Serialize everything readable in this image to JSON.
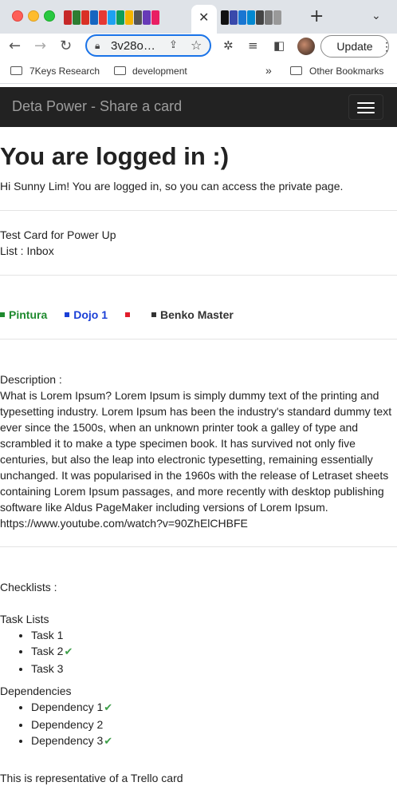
{
  "browser": {
    "url": "3v28o…",
    "update_label": "Update",
    "bookmarks": [
      "7Keys Research",
      "development"
    ],
    "bookmarks_more": "»",
    "other_bookmarks": "Other Bookmarks"
  },
  "navbar": {
    "brand": "Deta Power - Share a card"
  },
  "page": {
    "heading": "You are logged in :)",
    "greeting": "Hi Sunny Lim! You are logged in, so you can access the private page.",
    "card_name": "Test Card for Power Up",
    "card_list": "List : Inbox",
    "labels": [
      {
        "text": "Pintura",
        "color": "#1e8a2e"
      },
      {
        "text": "Dojo 1",
        "color": "#1a3fd6"
      },
      {
        "text": "",
        "color": "#e11d2b"
      },
      {
        "text": "Benko Master",
        "color": "#333333"
      }
    ],
    "description_label": "Description :",
    "description_text": "What is Lorem Ipsum? Lorem Ipsum is simply dummy text of the printing and typesetting industry. Lorem Ipsum has been the industry's standard dummy text ever since the 1500s, when an unknown printer took a galley of type and scrambled it to make a type specimen book. It has survived not only five centuries, but also the leap into electronic typesetting, remaining essentially unchanged. It was popularised in the 1960s with the release of Letraset sheets containing Lorem Ipsum passages, and more recently with desktop publishing software like Aldus PageMaker including versions of Lorem Ipsum.",
    "description_link": "https://www.youtube.com/watch?v=90ZhElCHBFE",
    "checklists_label": "Checklists :",
    "task_list_title": "Task Lists",
    "tasks": [
      {
        "text": "Task 1",
        "done": false
      },
      {
        "text": "Task 2",
        "done": true
      },
      {
        "text": "Task 3",
        "done": false
      }
    ],
    "dependencies_title": "Dependencies",
    "dependencies": [
      {
        "text": "Dependency 1",
        "done": true
      },
      {
        "text": "Dependency 2",
        "done": false
      },
      {
        "text": "Dependency 3",
        "done": true
      }
    ],
    "footer_text": "This is representative of a Trello card"
  }
}
